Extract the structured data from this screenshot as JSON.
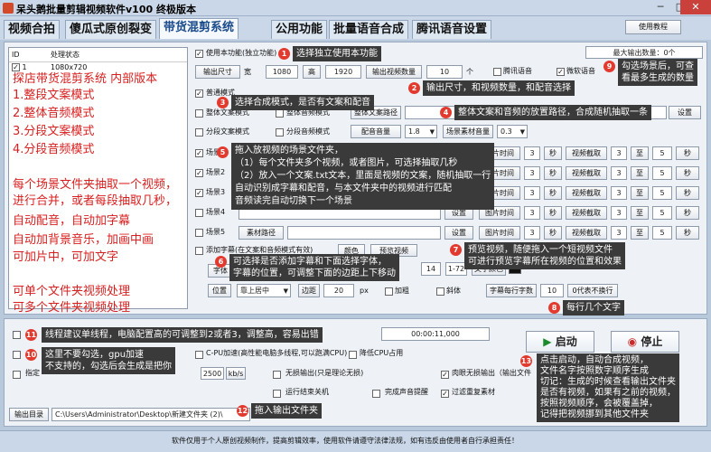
{
  "window": {
    "title": "呆头鹅批量剪辑视频软件v100 终极版本"
  },
  "tabs": [
    {
      "label": "视频合拍"
    },
    {
      "label": "傻瓜式原创裂变"
    },
    {
      "label": "带货混剪系统"
    },
    {
      "label": "公用功能"
    },
    {
      "label": "批量语音合成"
    },
    {
      "label": "腾讯语音设置"
    }
  ],
  "help_button": "使用教程",
  "table": {
    "col_id": "ID",
    "col_status": "处理状态",
    "row": {
      "id": "1",
      "status": "1080x720"
    }
  },
  "left_notes": {
    "title": "探店带货混剪系统 内部版本",
    "modes": [
      "1.整段文案模式",
      "2.整体音频模式",
      "3.分段文案模式",
      "4.分段音频模式"
    ],
    "desc": [
      "每个场景文件夹抽取一个视频，",
      "进行合并，或者每段抽取几秒，",
      "自动配音，自动加字幕",
      "自动加背景音乐，加画中画",
      "可加片中，可加文字"
    ],
    "bottom": [
      "可单个文件夹视频处理",
      "可多个文件夹视频处理"
    ]
  },
  "settings": {
    "use_feature": "使用本功能(独立功能)",
    "max_output": "最大输出数量：0个",
    "output_size": "输出尺寸",
    "width_label": "宽",
    "width": "1080",
    "height_label": "高",
    "height": "1920",
    "video_count_label": "输出视频数量",
    "video_count": "10",
    "count_unit": "个",
    "tencent_voice": "腾讯语音",
    "weiruan_voice": "微软语音",
    "normal_mode": "普通模式",
    "whole_text_mode": "整体文案模式",
    "whole_audio_mode": "整体音频模式",
    "whole_path_btn": "整体文案路径",
    "setting_btn": "设置",
    "segment_text_mode": "分段文案模式",
    "segment_audio_mode": "分段音频模式",
    "audio_volume_label": "配音音量",
    "audio_volume": "1.8",
    "scene_volume_label": "场景素材音量",
    "scene_volume": "0.3"
  },
  "scenes": [
    {
      "label": "场景1",
      "setting": "设置",
      "time_btn": "图片时间",
      "time": "3",
      "sec": "秒",
      "cut": "视频截取",
      "from": "3",
      "to_label": "至",
      "to": "5",
      "sec2": "秒"
    },
    {
      "label": "场景2",
      "setting": "设置",
      "time_btn": "图片时间",
      "time": "3",
      "sec": "秒",
      "cut": "视频截取",
      "from": "3",
      "to_label": "至",
      "to": "5",
      "sec2": "秒"
    },
    {
      "label": "场景3",
      "setting": "设置",
      "time_btn": "图片时间",
      "time": "3",
      "sec": "秒",
      "cut": "视频截取",
      "from": "3",
      "to_label": "至",
      "to": "5",
      "sec2": "秒"
    },
    {
      "label": "场景4",
      "setting": "设置",
      "time_btn": "图片时间",
      "time": "3",
      "sec": "秒",
      "cut": "视频截取",
      "from": "3",
      "to_label": "至",
      "to": "5",
      "sec2": "秒"
    },
    {
      "label": "场景5",
      "material": "素材路径",
      "setting": "设置",
      "time_btn": "图片时间",
      "time": "3",
      "sec": "秒",
      "cut": "视频截取",
      "from": "3",
      "to_label": "至",
      "to": "5",
      "sec2": "秒"
    }
  ],
  "subtitle": {
    "add_subtitle": "添加字幕(在文案和音频模式有效)",
    "font_btn": "字体",
    "preview_btn": "预览视频",
    "size": "14",
    "range": "1-72",
    "text_color": "文字颜色",
    "position_btn": "位置",
    "position": "靠上居中",
    "margin_label": "边距",
    "margin": "20",
    "margin_unit": "px",
    "bold": "加粗",
    "italic": "斜体",
    "chars_per_line": "字幕每行字数",
    "chars": "10",
    "no_wrap": "0代表不换行"
  },
  "bottom": {
    "thread_label": "线程建议单线程",
    "time": "00:00:11,000",
    "gpu_label": "GPU加速",
    "gpu_accel": "重剪",
    "cpu_accel": "C-PU加速(高性能电脑多线程,可以跑满CPU)",
    "lower_cpu": "降低CPU占用",
    "bitrate_label": "指定",
    "bitrate": "2500",
    "bitrate_unit": "kb/s",
    "seamless": "无损输出(只是理论无损)",
    "shutdown": "运行结束关机",
    "done_sound": "完成声音提醒",
    "memory": "肉眼无损输出（输出文件",
    "filter": "过滤重复素材",
    "output_dir_btn": "输出目录",
    "output_dir": "C:\\Users\\Administrator\\Desktop\\新建文件夹 (2)\\",
    "start": "启动",
    "stop": "停止"
  },
  "callouts": [
    {
      "n": "1",
      "text": "选择独立使用本功能"
    },
    {
      "n": "2",
      "text": "输出尺寸，和视频数量，和配音选择"
    },
    {
      "n": "3",
      "text": "选择合成模式，是否有文案和配音"
    },
    {
      "n": "4",
      "text": "整体文案和音频的放置路径，合成随机抽取一条"
    },
    {
      "n": "5",
      "lines": [
        "拖入放视频的场景文件夹，",
        "（1）每个文件夹多个视频，或者图片，可选择抽取几秒",
        "（2）放入一个文案.txt文本，里面是视频的文案，随机抽取一行",
        "自动识别成字幕和配音，与本文件夹中的视频进行匹配",
        "音频读完自动切换下一个场景"
      ]
    },
    {
      "n": "6",
      "lines": [
        "可选择是否添加字幕和下面选择字体，",
        "字幕的位置，可调整下面的边距上下移动"
      ]
    },
    {
      "n": "7",
      "lines": [
        "预览视频，随便拖入一个短视频文件",
        "可进行预览字幕所在视频的位置和效果"
      ]
    },
    {
      "n": "8",
      "text": "每行几个文字"
    },
    {
      "n": "9",
      "lines": [
        "勾选场景后，可查",
        "看最多生成的数量"
      ]
    },
    {
      "n": "11",
      "text": "线程建议单线程，电脑配置高的可调整到2或者3，调整高，容易出错"
    },
    {
      "n": "10",
      "lines": [
        "这里不要勾选，gpu加速",
        "不支持的，勾选后会生成是把你"
      ]
    },
    {
      "n": "12",
      "text": "拖入输出文件夹"
    },
    {
      "n": "13",
      "lines": [
        "点击启动，自动合成视频，",
        "文件名字按照数字顺序生成",
        "切记：生成的时候查看输出文件夹",
        "是否有视频，如果有之前的视频，",
        "按照视频顺序，会被覆盖掉，",
        "记得把视频挪到其他文件夹"
      ]
    }
  ],
  "footer": "软件仅用于个人原创视频制作，提高剪辑效率，使用软件请遵守法律法规，如有违反由使用者自行承担责任！"
}
